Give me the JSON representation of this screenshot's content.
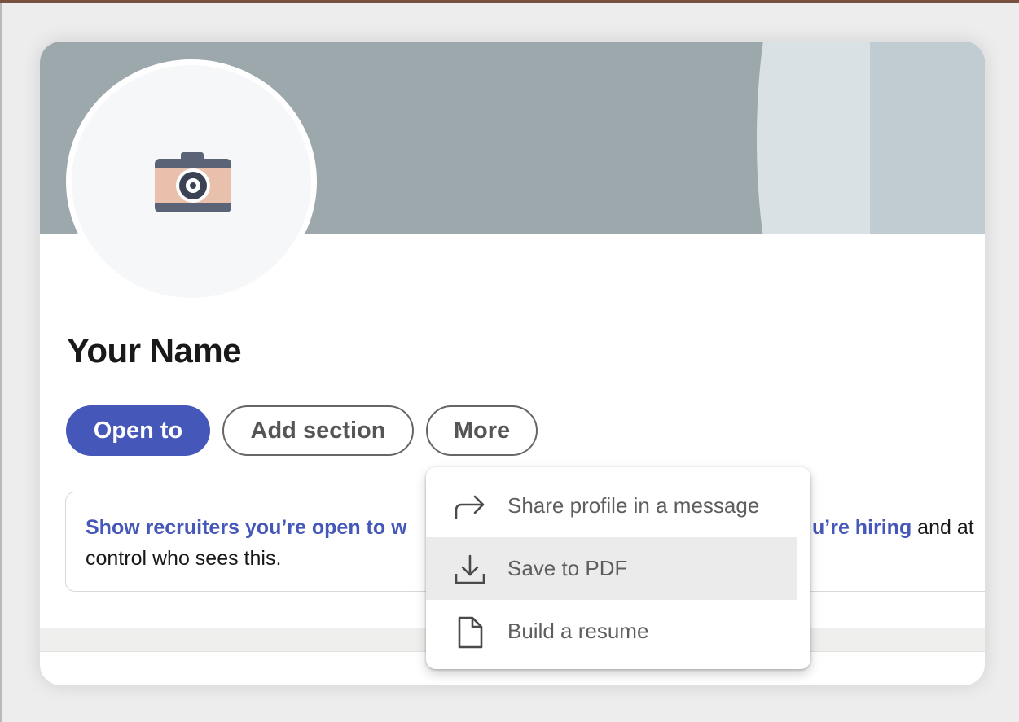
{
  "profile": {
    "name": "Your Name",
    "avatar_icon": "camera-icon"
  },
  "actions": {
    "open_to": "Open to",
    "add_section": "Add section",
    "more": "More"
  },
  "notice": {
    "link_start": "Show recruiters you’re open to w",
    "link_end": "u’re hiring",
    "text_end": " and at",
    "line2": "control who sees this."
  },
  "more_menu": {
    "items": [
      {
        "label": "Share profile in a message",
        "icon": "share-arrow-icon",
        "highlighted": false
      },
      {
        "label": "Save to PDF",
        "icon": "download-icon",
        "highlighted": true
      },
      {
        "label": "Build a resume",
        "icon": "document-icon",
        "highlighted": false
      }
    ]
  },
  "colors": {
    "accent": "#4557b8",
    "banner": "#9da8ad",
    "menu_hover": "#ebebeb"
  }
}
